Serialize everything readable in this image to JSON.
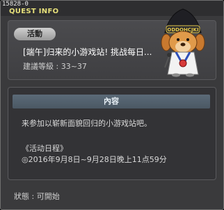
{
  "window": {
    "quest_id": "15828-0",
    "title": "QUEST INFO"
  },
  "header": {
    "category": "活動",
    "quest_title": "[端午]归来的小游戏站! 挑战每日...",
    "recommended_level": "建議等級 : 33~37",
    "npc_badge": "ODDOHCJKI"
  },
  "content": {
    "header": "內容",
    "description": "来参加以崭新面貌回归的小游戏站吧。",
    "schedule_title": "《活动日程》",
    "schedule_dates": "◎2016年9月8日~9月28日晚上11点59分"
  },
  "footer": {
    "status": "狀態 : 可開始"
  }
}
